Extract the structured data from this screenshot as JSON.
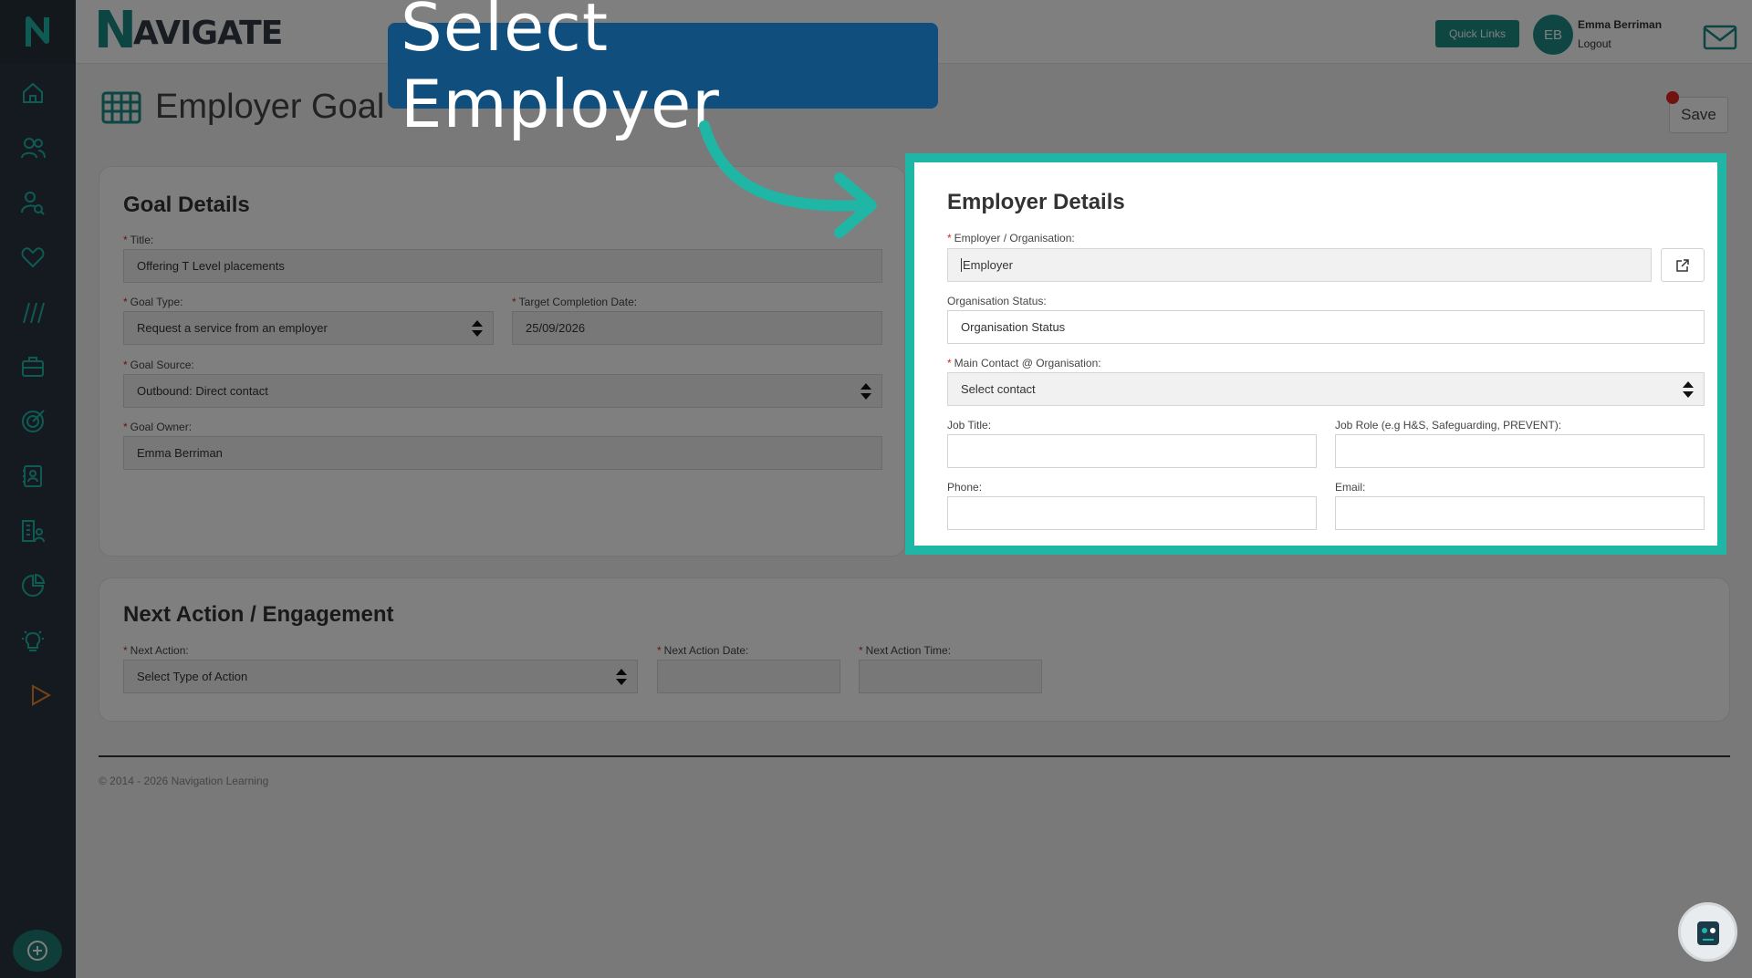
{
  "brand": {
    "first_letter": "N",
    "rest": "AVIGATE"
  },
  "topbar": {
    "quick_links": "Quick Links",
    "avatar_initials": "EB",
    "user_name": "Emma Berriman",
    "logout": "Logout"
  },
  "page": {
    "title": "Employer Goal",
    "save": "Save"
  },
  "goal_details": {
    "heading": "Goal Details",
    "title_label": "Title:",
    "title_value": "Offering T Level placements",
    "goal_type_label": "Goal Type:",
    "goal_type_value": "Request a service from an employer",
    "target_date_label": "Target Completion Date:",
    "target_date_value": "25/09/2026",
    "goal_source_label": "Goal Source:",
    "goal_source_value": "Outbound: Direct contact",
    "goal_owner_label": "Goal Owner:",
    "goal_owner_value": "Emma Berriman"
  },
  "employer_details": {
    "heading": "Employer Details",
    "employer_label": "Employer / Organisation:",
    "employer_value": "Employer",
    "org_status_label": "Organisation Status:",
    "org_status_placeholder": "Organisation Status",
    "main_contact_label": "Main Contact @ Organisation:",
    "main_contact_value": "Select contact",
    "job_title_label": "Job Title:",
    "job_role_label": "Job Role (e.g H&S, Safeguarding, PREVENT):",
    "phone_label": "Phone:",
    "email_label": "Email:"
  },
  "next_action": {
    "heading": "Next Action / Engagement",
    "action_label": "Next Action:",
    "action_value": "Select Type of Action",
    "date_label": "Next Action Date:",
    "time_label": "Next Action Time:"
  },
  "footer": {
    "copyright": "© 2014 - 2026 Navigation Learning"
  },
  "callout": {
    "text": "Select Employer"
  },
  "colors": {
    "accent": "#1fb6a6",
    "callout_bg": "#0f4e7d",
    "brand_teal": "#1a8a84",
    "sidebar": "#2b3440"
  },
  "icons": [
    "home-icon",
    "users-icon",
    "user-search-icon",
    "heart-icon",
    "slashes-icon",
    "briefcase-icon",
    "target-icon",
    "contact-book-icon",
    "building-users-icon",
    "pie-chart-icon",
    "lightbulb-icon",
    "play-icon",
    "plus-circle-icon",
    "mail-icon",
    "external-link-icon"
  ]
}
